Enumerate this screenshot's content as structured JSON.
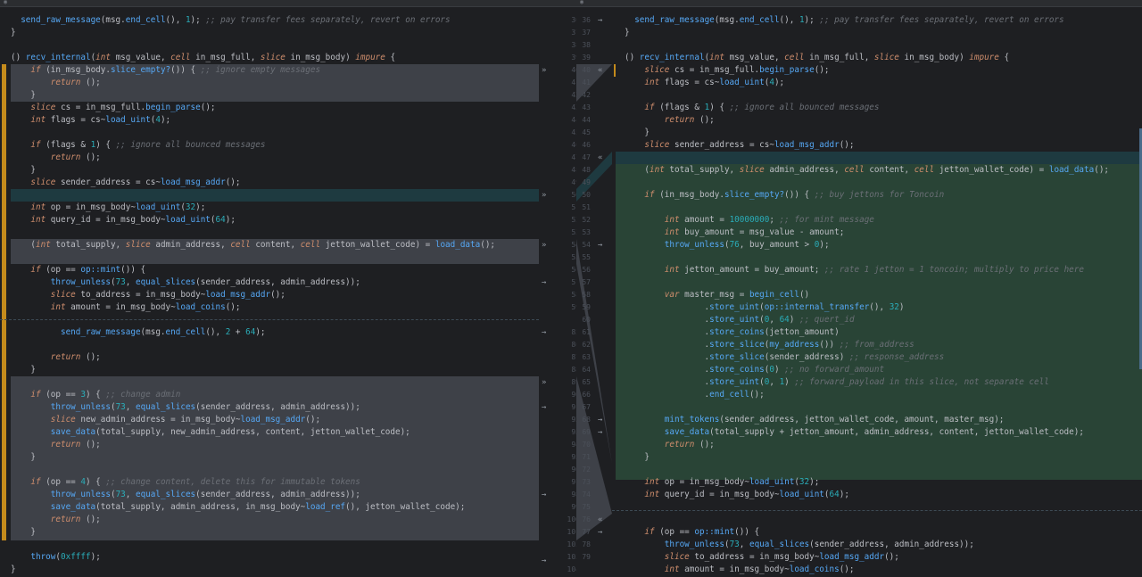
{
  "left": {
    "lines": [
      {
        "no": "",
        "text": "  send_raw_message(msg.end_cell(), 1); ;; pay transfer fees separately, revert on errors"
      },
      {
        "no": "",
        "text": "}"
      },
      {
        "no": "",
        "text": ""
      },
      {
        "no": "",
        "text": "() recv_internal(int msg_value, cell in_msg_full, slice in_msg_body) impure {"
      },
      {
        "no": "",
        "text": "    if (in_msg_body.slice_empty?()) { ;; ignore empty messages"
      },
      {
        "no": "",
        "text": "        return ();"
      },
      {
        "no": "",
        "text": "    }"
      },
      {
        "no": "",
        "text": "    slice cs = in_msg_full.begin_parse();"
      },
      {
        "no": "",
        "text": "    int flags = cs~load_uint(4);"
      },
      {
        "no": "",
        "text": ""
      },
      {
        "no": "",
        "text": "    if (flags & 1) { ;; ignore all bounced messages"
      },
      {
        "no": "",
        "text": "        return ();"
      },
      {
        "no": "",
        "text": "    }"
      },
      {
        "no": "",
        "text": "    slice sender_address = cs~load_msg_addr();"
      },
      {
        "no": "",
        "text": ""
      },
      {
        "no": "",
        "text": "    int op = in_msg_body~load_uint(32);"
      },
      {
        "no": "",
        "text": "    int query_id = in_msg_body~load_uint(64);"
      },
      {
        "no": "",
        "text": ""
      },
      {
        "no": "",
        "text": "    (int total_supply, slice admin_address, cell content, cell jetton_wallet_code) = load_data();"
      },
      {
        "no": "",
        "text": ""
      },
      {
        "no": "",
        "text": "    if (op == op::mint()) {"
      },
      {
        "no": "",
        "text": "        throw_unless(73, equal_slices(sender_address, admin_address));"
      },
      {
        "no": "",
        "text": "        slice to_address = in_msg_body~load_msg_addr();"
      },
      {
        "no": "",
        "text": "        int amount = in_msg_body~load_coins();"
      },
      {
        "no": "",
        "text": ""
      },
      {
        "no": "",
        "text": "          send_raw_message(msg.end_cell(), 2 + 64);"
      },
      {
        "no": "",
        "text": ""
      },
      {
        "no": "",
        "text": "        return ();"
      },
      {
        "no": "",
        "text": "    }"
      },
      {
        "no": "",
        "text": ""
      },
      {
        "no": "",
        "text": "    if (op == 3) { ;; change admin"
      },
      {
        "no": "",
        "text": "        throw_unless(73, equal_slices(sender_address, admin_address));"
      },
      {
        "no": "",
        "text": "        slice new_admin_address = in_msg_body~load_msg_addr();"
      },
      {
        "no": "",
        "text": "        save_data(total_supply, new_admin_address, content, jetton_wallet_code);"
      },
      {
        "no": "",
        "text": "        return ();"
      },
      {
        "no": "",
        "text": "    }"
      },
      {
        "no": "",
        "text": ""
      },
      {
        "no": "",
        "text": "    if (op == 4) { ;; change content, delete this for immutable tokens"
      },
      {
        "no": "",
        "text": "        throw_unless(73, equal_slices(sender_address, admin_address));"
      },
      {
        "no": "",
        "text": "        save_data(total_supply, admin_address, in_msg_body~load_ref(), jetton_wallet_code);"
      },
      {
        "no": "",
        "text": "        return ();"
      },
      {
        "no": "",
        "text": "    }"
      },
      {
        "no": "",
        "text": ""
      },
      {
        "no": "",
        "text": "    throw(0xffff);"
      },
      {
        "no": "",
        "text": "}"
      }
    ]
  },
  "left_gutter_numbers": [
    "36",
    "37",
    "38",
    "39",
    "40",
    "41",
    "42",
    "43",
    "44",
    "45",
    "46",
    "47",
    "48",
    "49",
    "50",
    "51",
    "52",
    "53",
    "54",
    "55",
    "56",
    "57",
    "58",
    "59",
    "",
    "85",
    "86",
    "87",
    "88",
    "89",
    "90",
    "91",
    "92",
    "93",
    "94",
    "95",
    "96",
    "97",
    "98",
    "99",
    "100",
    "101",
    "102",
    "103",
    "104"
  ],
  "right": {
    "lines": [
      {
        "text": "  send_raw_message(msg.end_cell(), 1); ;; pay transfer fees separately, revert on errors"
      },
      {
        "text": "}"
      },
      {
        "text": ""
      },
      {
        "text": "() recv_internal(int msg_value, cell in_msg_full, slice in_msg_body) impure {"
      },
      {
        "text": "    slice cs = in_msg_full.begin_parse();"
      },
      {
        "text": "    int flags = cs~load_uint(4);"
      },
      {
        "text": ""
      },
      {
        "text": "    if (flags & 1) { ;; ignore all bounced messages"
      },
      {
        "text": "        return ();"
      },
      {
        "text": "    }"
      },
      {
        "text": "    slice sender_address = cs~load_msg_addr();"
      },
      {
        "text": ""
      },
      {
        "text": "    (int total_supply, slice admin_address, cell content, cell jetton_wallet_code) = load_data();"
      },
      {
        "text": ""
      },
      {
        "text": "    if (in_msg_body.slice_empty?()) { ;; buy jettons for Toncoin"
      },
      {
        "text": ""
      },
      {
        "text": "        int amount = 10000000; ;; for mint message"
      },
      {
        "text": "        int buy_amount = msg_value - amount;"
      },
      {
        "text": "        throw_unless(76, buy_amount > 0);"
      },
      {
        "text": ""
      },
      {
        "text": "        int jetton_amount = buy_amount; ;; rate 1 jetton = 1 toncoin; multiply to price here"
      },
      {
        "text": ""
      },
      {
        "text": "        var master_msg = begin_cell()"
      },
      {
        "text": "                .store_uint(op::internal_transfer(), 32)"
      },
      {
        "text": "                .store_uint(0, 64) ;; quert_id"
      },
      {
        "text": "                .store_coins(jetton_amount)"
      },
      {
        "text": "                .store_slice(my_address()) ;; from_address"
      },
      {
        "text": "                .store_slice(sender_address) ;; response_address"
      },
      {
        "text": "                .store_coins(0) ;; no forward_amount"
      },
      {
        "text": "                .store_uint(0, 1) ;; forward_payload in this slice, not separate cell"
      },
      {
        "text": "                .end_cell();"
      },
      {
        "text": ""
      },
      {
        "text": "        mint_tokens(sender_address, jetton_wallet_code, amount, master_msg);"
      },
      {
        "text": "        save_data(total_supply + jetton_amount, admin_address, content, jetton_wallet_code);"
      },
      {
        "text": "        return ();"
      },
      {
        "text": "    }"
      },
      {
        "text": ""
      },
      {
        "text": "    int op = in_msg_body~load_uint(32);"
      },
      {
        "text": "    int query_id = in_msg_body~load_uint(64);"
      },
      {
        "text": ""
      },
      {
        "text": ""
      },
      {
        "text": "    if (op == op::mint()) {"
      },
      {
        "text": "        throw_unless(73, equal_slices(sender_address, admin_address));"
      },
      {
        "text": "        slice to_address = in_msg_body~load_msg_addr();"
      },
      {
        "text": "        int amount = in_msg_body~load_coins();"
      }
    ]
  },
  "right_gutter_numbers": [
    "36",
    "37",
    "38",
    "39",
    "40",
    "41",
    "42",
    "43",
    "44",
    "45",
    "46",
    "47",
    "48",
    "49",
    "50",
    "51",
    "52",
    "53",
    "54",
    "55",
    "56",
    "57",
    "58",
    "59",
    "60",
    "61",
    "62",
    "63",
    "64",
    "65",
    "66",
    "67",
    "68",
    "69",
    "70",
    "71",
    "72",
    "73",
    "74",
    "75",
    "76",
    "77",
    "78",
    "79"
  ],
  "icons": {
    "apply_right": "double-chevron-right-icon",
    "apply_left": "double-chevron-left-icon",
    "accept": "accept-arrow-icon"
  },
  "colors": {
    "background": "#1e1f22",
    "changed_block": "#3e4148",
    "inserted_block": "#294436",
    "modified_line": "#1e3a40",
    "keyword": "#cf8e6d",
    "function": "#56a8f5",
    "comment": "#6b6f76",
    "number": "#2aacb8",
    "change_marker": "#c48b1c"
  }
}
